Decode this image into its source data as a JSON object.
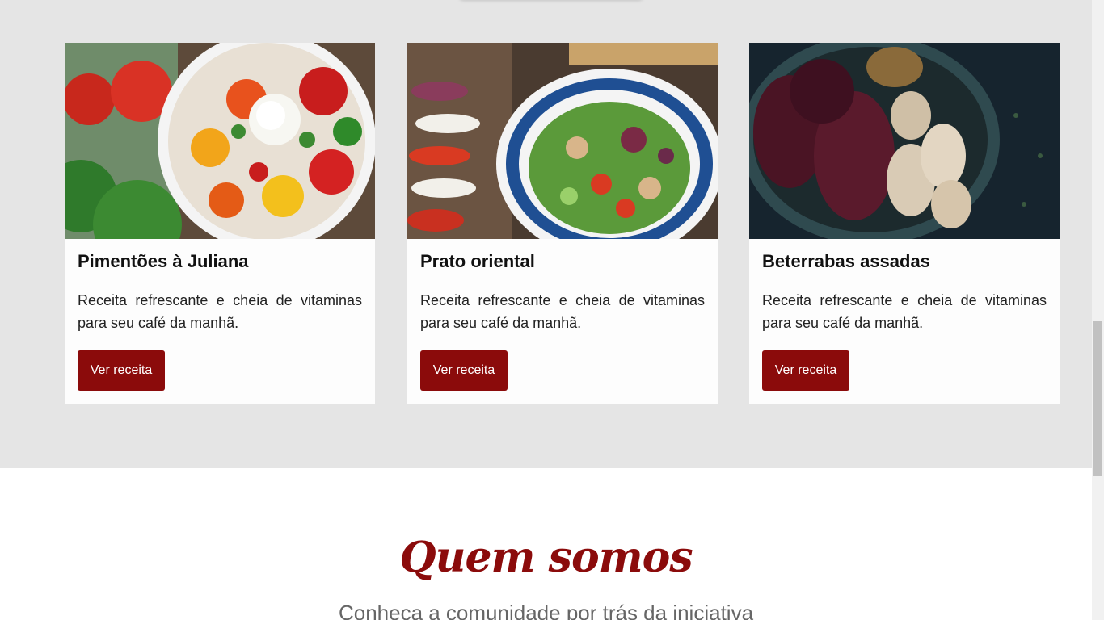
{
  "recipes": [
    {
      "title": "Pimentões à Juliana",
      "description": "Receita refrescante e cheia de vitaminas para seu café da manhã.",
      "button_label": "Ver receita"
    },
    {
      "title": "Prato oriental",
      "description": "Receita refrescante e cheia de vitaminas para seu café da manhã.",
      "button_label": "Ver receita"
    },
    {
      "title": "Beterrabas assadas",
      "description": "Receita refrescante e cheia de vitaminas para seu café da manhã.",
      "button_label": "Ver receita"
    }
  ],
  "about": {
    "title": "Quem somos",
    "subtitle": "Conheça a comunidade por trás da iniciativa"
  },
  "colors": {
    "accent": "#8b0b0b",
    "section_bg": "#e5e5e5",
    "card_bg": "#fdfdfd"
  }
}
